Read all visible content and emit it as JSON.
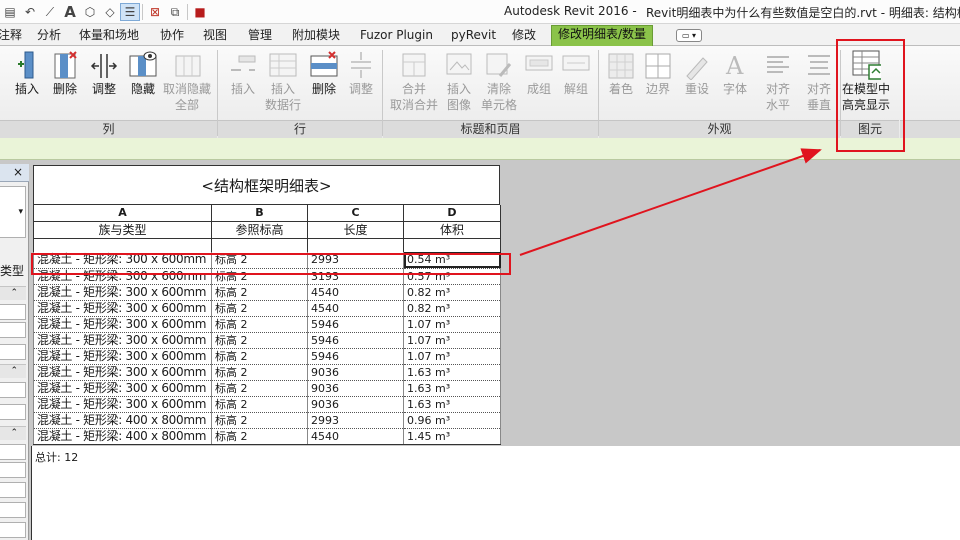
{
  "titlebar": {
    "app_title": "Autodesk Revit 2016 -",
    "doc_title": "Revit明细表中为什么有些数值是空白的.rvt - 明细表: 结构框"
  },
  "quick_access": [
    "open-icon",
    "undo-icon",
    "measure-icon",
    "text-icon",
    "3d-view-icon",
    "section-icon",
    "thin-lines-icon",
    "close-hidden-icon",
    "switch-windows-icon",
    "family-icon"
  ],
  "tabs": [
    {
      "label": "注释",
      "active": false
    },
    {
      "label": "分析",
      "active": false
    },
    {
      "label": "体量和场地",
      "active": false
    },
    {
      "label": "协作",
      "active": false
    },
    {
      "label": "视图",
      "active": false
    },
    {
      "label": "管理",
      "active": false
    },
    {
      "label": "附加模块",
      "active": false
    },
    {
      "label": "Fuzor Plugin",
      "active": false
    },
    {
      "label": "pyRevit",
      "active": false
    },
    {
      "label": "修改",
      "active": false
    },
    {
      "label": "修改明细表/数量",
      "active": true
    }
  ],
  "ribbon": {
    "buttons": [
      {
        "label": "插入",
        "enabled": true,
        "icon": "insert-column-icon"
      },
      {
        "label": "删除",
        "enabled": true,
        "icon": "delete-column-icon"
      },
      {
        "label": "调整",
        "enabled": true,
        "icon": "resize-column-icon"
      },
      {
        "label": "隐藏",
        "enabled": true,
        "icon": "hide-column-icon"
      },
      {
        "label": "取消隐藏\n全部",
        "enabled": false,
        "icon": "unhide-all-icon"
      },
      {
        "label": "插入",
        "enabled": false,
        "icon": "insert-row-icon"
      },
      {
        "label": "插入\n数据行",
        "enabled": false,
        "icon": "insert-data-row-icon"
      },
      {
        "label": "删除",
        "enabled": true,
        "icon": "delete-row-icon"
      },
      {
        "label": "调整",
        "enabled": false,
        "icon": "resize-row-icon"
      },
      {
        "label": "合并\n取消合并",
        "enabled": false,
        "icon": "merge-icon"
      },
      {
        "label": "插入\n图像",
        "enabled": false,
        "icon": "insert-image-icon"
      },
      {
        "label": "清除\n单元格",
        "enabled": false,
        "icon": "clear-cell-icon"
      },
      {
        "label": "成组",
        "enabled": false,
        "icon": "group-icon"
      },
      {
        "label": "解组",
        "enabled": false,
        "icon": "ungroup-icon"
      },
      {
        "label": "着色",
        "enabled": false,
        "icon": "shading-icon"
      },
      {
        "label": "边界",
        "enabled": false,
        "icon": "borders-icon"
      },
      {
        "label": "重设",
        "enabled": false,
        "icon": "reset-icon"
      },
      {
        "label": "字体",
        "enabled": false,
        "icon": "font-icon"
      },
      {
        "label": "对齐\n水平",
        "enabled": false,
        "icon": "align-horizontal-icon"
      },
      {
        "label": "对齐\n垂直",
        "enabled": false,
        "icon": "align-vertical-icon"
      },
      {
        "label": "在模型中\n高亮显示",
        "enabled": true,
        "icon": "highlight-in-model-icon"
      }
    ],
    "groups": [
      "列",
      "行",
      "标题和页眉",
      "外观",
      "图元"
    ]
  },
  "left_panel": {
    "close": "×",
    "type_label": "类型"
  },
  "schedule": {
    "title": "<结构框架明细表>",
    "column_letters": [
      "A",
      "B",
      "C",
      "D"
    ],
    "column_names": [
      "族与类型",
      "参照标高",
      "长度",
      "体积"
    ],
    "rows": [
      [
        "混凝土 - 矩形梁: 300 x 600mm",
        "标高 2",
        "2993",
        "0.54 m³"
      ],
      [
        "混凝土 - 矩形梁: 300 x 600mm",
        "标高 2",
        "3193",
        "0.57 m³"
      ],
      [
        "混凝土 - 矩形梁: 300 x 600mm",
        "标高 2",
        "4540",
        "0.82 m³"
      ],
      [
        "混凝土 - 矩形梁: 300 x 600mm",
        "标高 2",
        "4540",
        "0.82 m³"
      ],
      [
        "混凝土 - 矩形梁: 300 x 600mm",
        "标高 2",
        "5946",
        "1.07 m³"
      ],
      [
        "混凝土 - 矩形梁: 300 x 600mm",
        "标高 2",
        "5946",
        "1.07 m³"
      ],
      [
        "混凝土 - 矩形梁: 300 x 600mm",
        "标高 2",
        "5946",
        "1.07 m³"
      ],
      [
        "混凝土 - 矩形梁: 300 x 600mm",
        "标高 2",
        "9036",
        "1.63 m³"
      ],
      [
        "混凝土 - 矩形梁: 300 x 600mm",
        "标高 2",
        "9036",
        "1.63 m³"
      ],
      [
        "混凝土 - 矩形梁: 300 x 600mm",
        "标高 2",
        "9036",
        "1.63 m³"
      ],
      [
        "混凝土 - 矩形梁: 400 x 800mm",
        "标高 2",
        "2993",
        "0.96 m³"
      ],
      [
        "混凝土 - 矩形梁: 400 x 800mm",
        "标高 2",
        "4540",
        "1.45 m³"
      ]
    ],
    "selected_row": 0,
    "total": "总计: 12"
  },
  "colors": {
    "active_tab": "#8bc34a",
    "annotation_red": "#e0141e",
    "options_bar": "#eaf4d8"
  }
}
